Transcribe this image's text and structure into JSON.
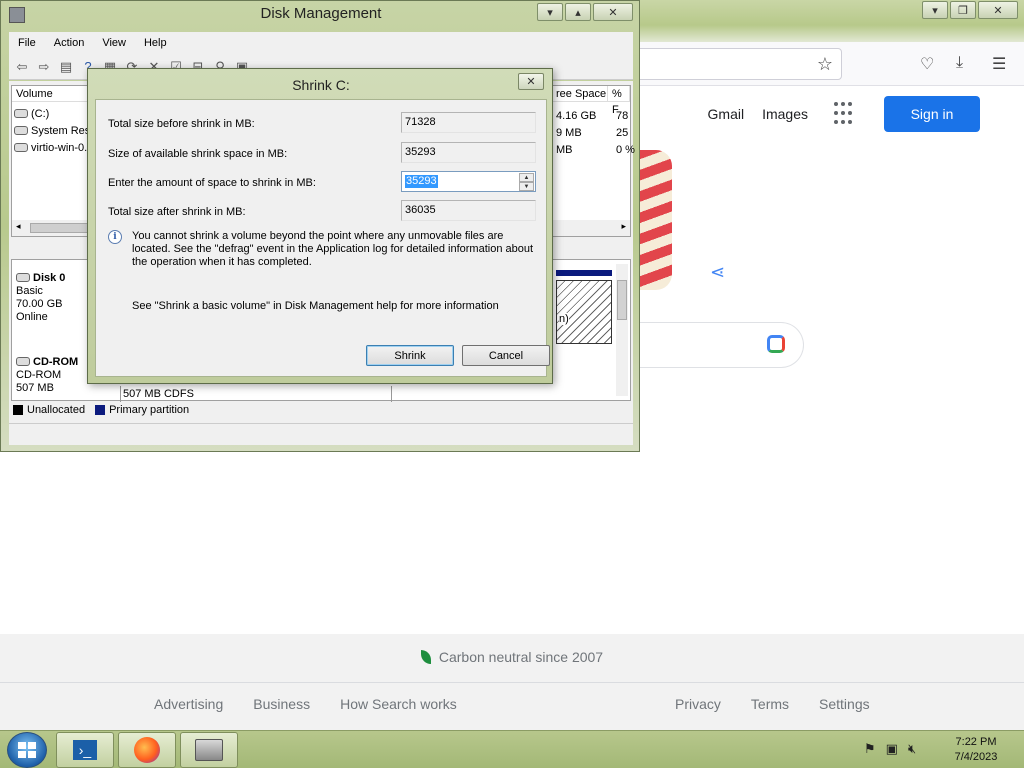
{
  "browser": {
    "header_links": [
      "Gmail",
      "Images"
    ],
    "sign_in": "Sign in",
    "footer": {
      "carbon": "Carbon neutral since 2007",
      "left_links": [
        "Advertising",
        "Business",
        "How Search works"
      ],
      "right_links": [
        "Privacy",
        "Terms",
        "Settings"
      ]
    },
    "accent": "#1a73e8"
  },
  "disk_mgmt": {
    "title": "Disk Management",
    "menu": [
      "File",
      "Action",
      "View",
      "Help"
    ],
    "columns": {
      "volume": "Volume",
      "free_space": "ree Space",
      "pct": "% F"
    },
    "volumes": [
      {
        "name": "(C:)",
        "free": "4.16 GB",
        "pct": "78"
      },
      {
        "name": "System Rese",
        "free": "9 MB",
        "pct": "25"
      },
      {
        "name": "virtio-win-0.",
        "free": "MB",
        "pct": "0 %"
      }
    ],
    "disk0": {
      "name": "Disk 0",
      "type": "Basic",
      "size": "70.00 GB",
      "status": "Online",
      "partition_tail": "n)"
    },
    "cdrom": {
      "name": "CD-ROM",
      "type": "CD-ROM",
      "size": "507 MB",
      "partition": "507 MB CDFS"
    },
    "legend": {
      "unallocated": "Unallocated",
      "primary": "Primary partition"
    }
  },
  "shrink_dialog": {
    "title": "Shrink C:",
    "rows": [
      {
        "label": "Total size before shrink in MB:",
        "value": "71328"
      },
      {
        "label": "Size of available shrink space in MB:",
        "value": "35293"
      },
      {
        "label": "Enter the amount of space to shrink in MB:",
        "value": "35293"
      },
      {
        "label": "Total size after shrink in MB:",
        "value": "36035"
      }
    ],
    "info": "You cannot shrink a volume beyond the point where any unmovable files are located. See the \"defrag\" event in the Application log for detailed information about the operation when it has completed.",
    "help": "See \"Shrink a basic volume\" in Disk Management help for more information",
    "buttons": {
      "shrink": "Shrink",
      "cancel": "Cancel"
    }
  },
  "taskbar": {
    "clock_time": "7:22 PM",
    "clock_date": "7/4/2023"
  }
}
